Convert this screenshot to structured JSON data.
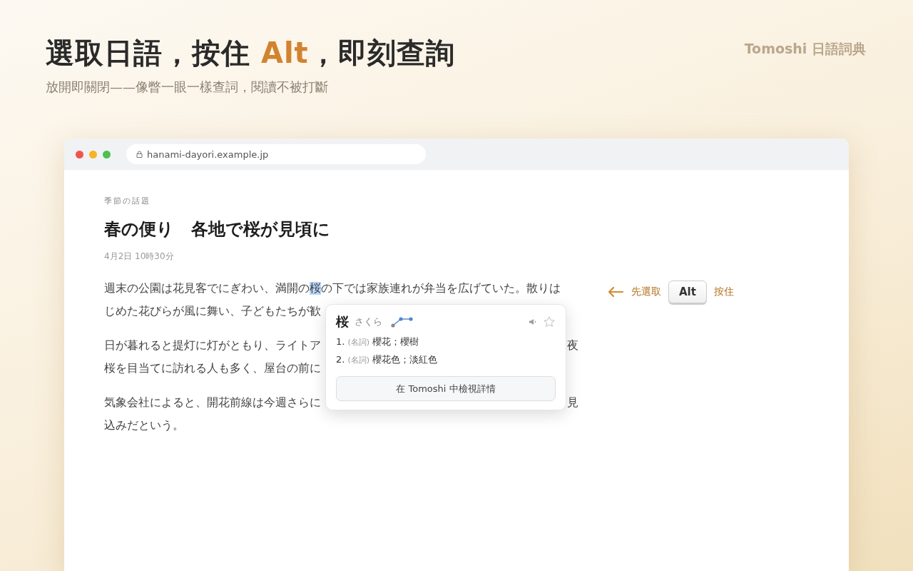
{
  "hero": {
    "title": [
      {
        "text": "選取日語，按住 ",
        "accent": false
      },
      {
        "text": "Alt",
        "accent": true
      },
      {
        "text": "，即刻查詢",
        "accent": false
      }
    ],
    "subtitle": "放開即關閉——像瞥一眼一樣查詞，閱讀不被打斷",
    "brand": "Tomoshi 日語詞典"
  },
  "browser": {
    "url": "hanami-dayori.example.jp"
  },
  "article": {
    "category": "季節の話題",
    "headline": "春の便り　各地で桜が見頃に",
    "date": "4月2日 10時30分",
    "paragraphs": [
      [
        {
          "left": [
            {
              "text": "週末の公園は花見客でにぎわい、満開の",
              "selected": false
            },
            {
              "text": "桜",
              "selected": true
            },
            {
              "text": "の下では家族連れが弁当を広げていた。散りは",
              "selected": false
            }
          ]
        },
        {
          "left": [
            {
              "text": "じめた花びらが風に舞い、子どもたちが歓",
              "selected": false
            }
          ]
        }
      ],
      [
        {
          "left": [
            {
              "text": "日が暮れると提灯に灯がともり、ライトア",
              "selected": false
            }
          ],
          "right": "夜"
        },
        {
          "left": [
            {
              "text": "桜を目当てに訪れる人も多く、屋台の前に",
              "selected": false
            }
          ]
        }
      ],
      [
        {
          "left": [
            {
              "text": "気象会社によると、開花前線は今週さらに",
              "selected": false
            }
          ],
          "right": "見"
        },
        {
          "left": [
            {
              "text": "込みだという。",
              "selected": false
            }
          ]
        }
      ]
    ]
  },
  "popup": {
    "word": "桜",
    "reading": "さくら",
    "senses": [
      {
        "number": "1.",
        "pos": "(名詞)",
        "meaning": "櫻花；櫻樹"
      },
      {
        "number": "2.",
        "pos": "(名詞)",
        "meaning": "櫻花色；淡紅色"
      }
    ],
    "favorite": false,
    "details_button": "在 Tomoshi 中檢視詳情"
  },
  "hint": {
    "before": "先選取",
    "key": "Alt",
    "after": "按住"
  }
}
